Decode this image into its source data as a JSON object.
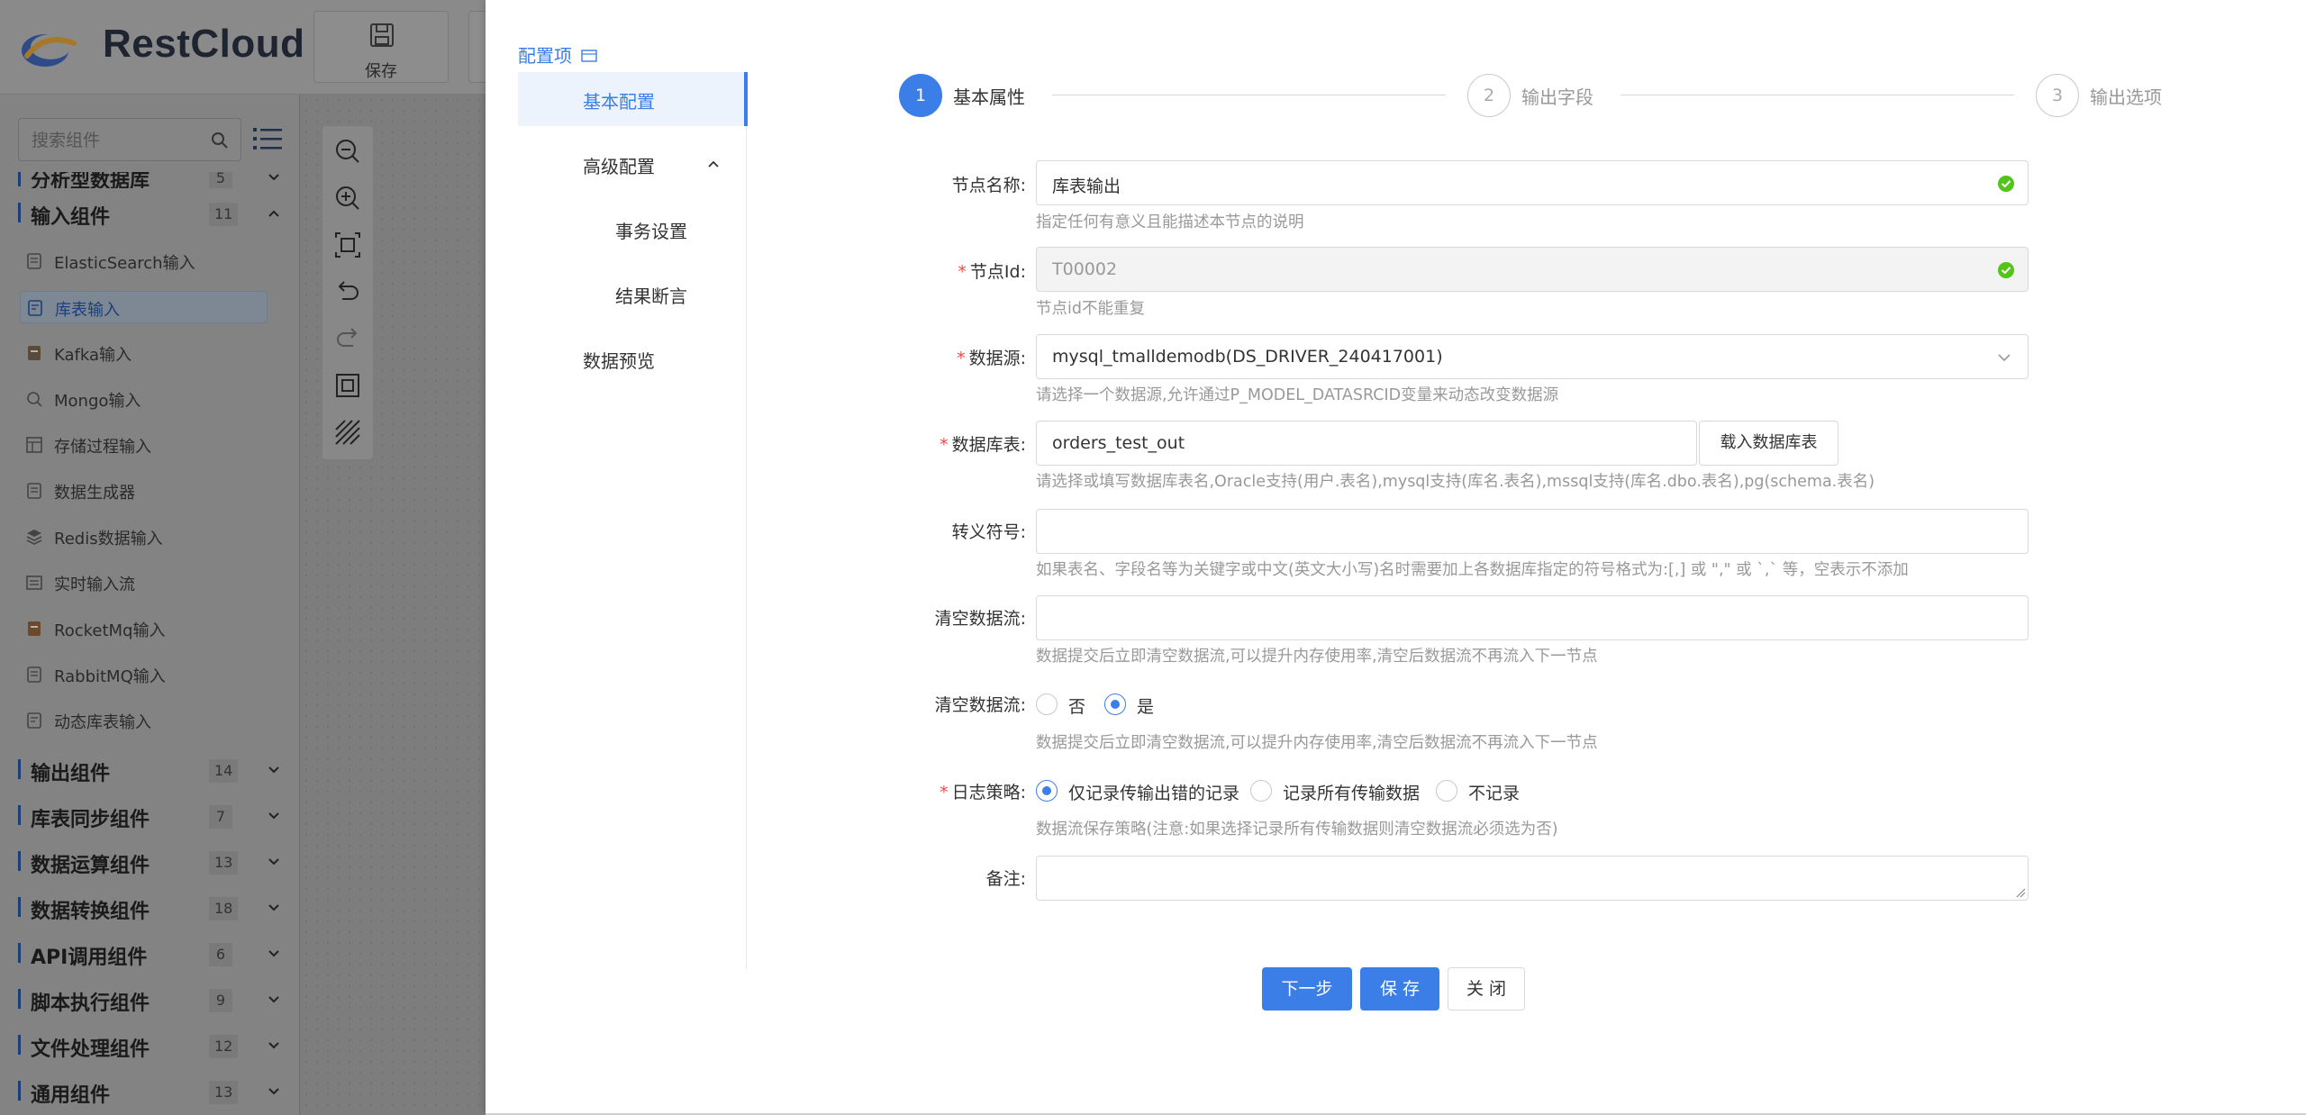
{
  "app": {
    "logo_text": "RestCloud",
    "save_label": "保存"
  },
  "sidebar": {
    "search_placeholder": "搜索组件",
    "partial_category": {
      "name": "分析型数据库",
      "count": "5"
    },
    "input_category": {
      "name": "输入组件",
      "count": "11"
    },
    "input_items": [
      {
        "label": "ElasticSearch输入",
        "icon": "elasticsearch-icon"
      },
      {
        "label": "库表输入",
        "icon": "table-input-icon"
      },
      {
        "label": "Kafka输入",
        "icon": "kafka-icon"
      },
      {
        "label": "Mongo输入",
        "icon": "mongo-icon"
      },
      {
        "label": "存储过程输入",
        "icon": "procedure-icon"
      },
      {
        "label": "数据生成器",
        "icon": "generator-icon"
      },
      {
        "label": "Redis数据输入",
        "icon": "redis-icon"
      },
      {
        "label": "实时输入流",
        "icon": "stream-icon"
      },
      {
        "label": "RocketMq输入",
        "icon": "rocketmq-icon"
      },
      {
        "label": "RabbitMQ输入",
        "icon": "rabbitmq-icon"
      },
      {
        "label": "动态库表输入",
        "icon": "dynamic-table-icon"
      }
    ],
    "categories": [
      {
        "name": "输出组件",
        "count": "14"
      },
      {
        "name": "库表同步组件",
        "count": "7"
      },
      {
        "name": "数据运算组件",
        "count": "13"
      },
      {
        "name": "数据转换组件",
        "count": "18"
      },
      {
        "name": "API调用组件",
        "count": "6"
      },
      {
        "name": "脚本执行组件",
        "count": "9"
      },
      {
        "name": "文件处理组件",
        "count": "12"
      },
      {
        "name": "通用组件",
        "count": "13"
      }
    ]
  },
  "drawer": {
    "config_title": "配置项",
    "menu": {
      "basic": "基本配置",
      "advanced": "高级配置",
      "transaction": "事务设置",
      "assertion": "结果断言",
      "preview": "数据预览"
    },
    "steps": [
      {
        "num": "1",
        "label": "基本属性"
      },
      {
        "num": "2",
        "label": "输出字段"
      },
      {
        "num": "3",
        "label": "输出选项"
      }
    ],
    "form": {
      "node_name": {
        "label": "节点名称:",
        "value": "库表输出",
        "help": "指定任何有意义且能描述本节点的说明"
      },
      "node_id": {
        "label": "节点Id:",
        "value": "T00002",
        "help": "节点id不能重复"
      },
      "datasource": {
        "label": "数据源:",
        "value": "mysql_tmalldemodb(DS_DRIVER_240417001)",
        "help": "请选择一个数据源,允许通过P_MODEL_DATASRCID变量来动态改变数据源"
      },
      "table": {
        "label": "数据库表:",
        "value": "orders_test_out",
        "button": "载入数据库表",
        "help": "请选择或填写数据库表名,Oracle支持(用户.表名),mysql支持(库名.表名),mssql支持(库名.dbo.表名),pg(schema.表名)"
      },
      "escape": {
        "label": "转义符号:",
        "value": "",
        "help": "如果表名、字段名等为关键字或中文(英文大小写)名时需要加上各数据库指定的符号格式为:[,] 或 \",\" 或 `,` 等，空表示不添加"
      },
      "clear_stream_input": {
        "label": "清空数据流:",
        "value": "",
        "help": "数据提交后立即清空数据流,可以提升内存使用率,清空后数据流不再流入下一节点"
      },
      "clear_stream_radio": {
        "label": "清空数据流:",
        "options": [
          "否",
          "是"
        ],
        "selected": "是",
        "help": "数据提交后立即清空数据流,可以提升内存使用率,清空后数据流不再流入下一节点"
      },
      "log_policy": {
        "label": "日志策略:",
        "options": [
          "仅记录传输出错的记录",
          "记录所有传输数据",
          "不记录"
        ],
        "selected": "仅记录传输出错的记录",
        "help": "数据流保存策略(注意:如果选择记录所有传输数据则清空数据流必须选为否)"
      },
      "remark": {
        "label": "备注:",
        "value": ""
      }
    },
    "buttons": {
      "next": "下一步",
      "save": "保 存",
      "close": "关 闭"
    },
    "colors": {
      "primary": "#3b7ee8",
      "required": "#f04848",
      "success": "#52c41a"
    }
  }
}
